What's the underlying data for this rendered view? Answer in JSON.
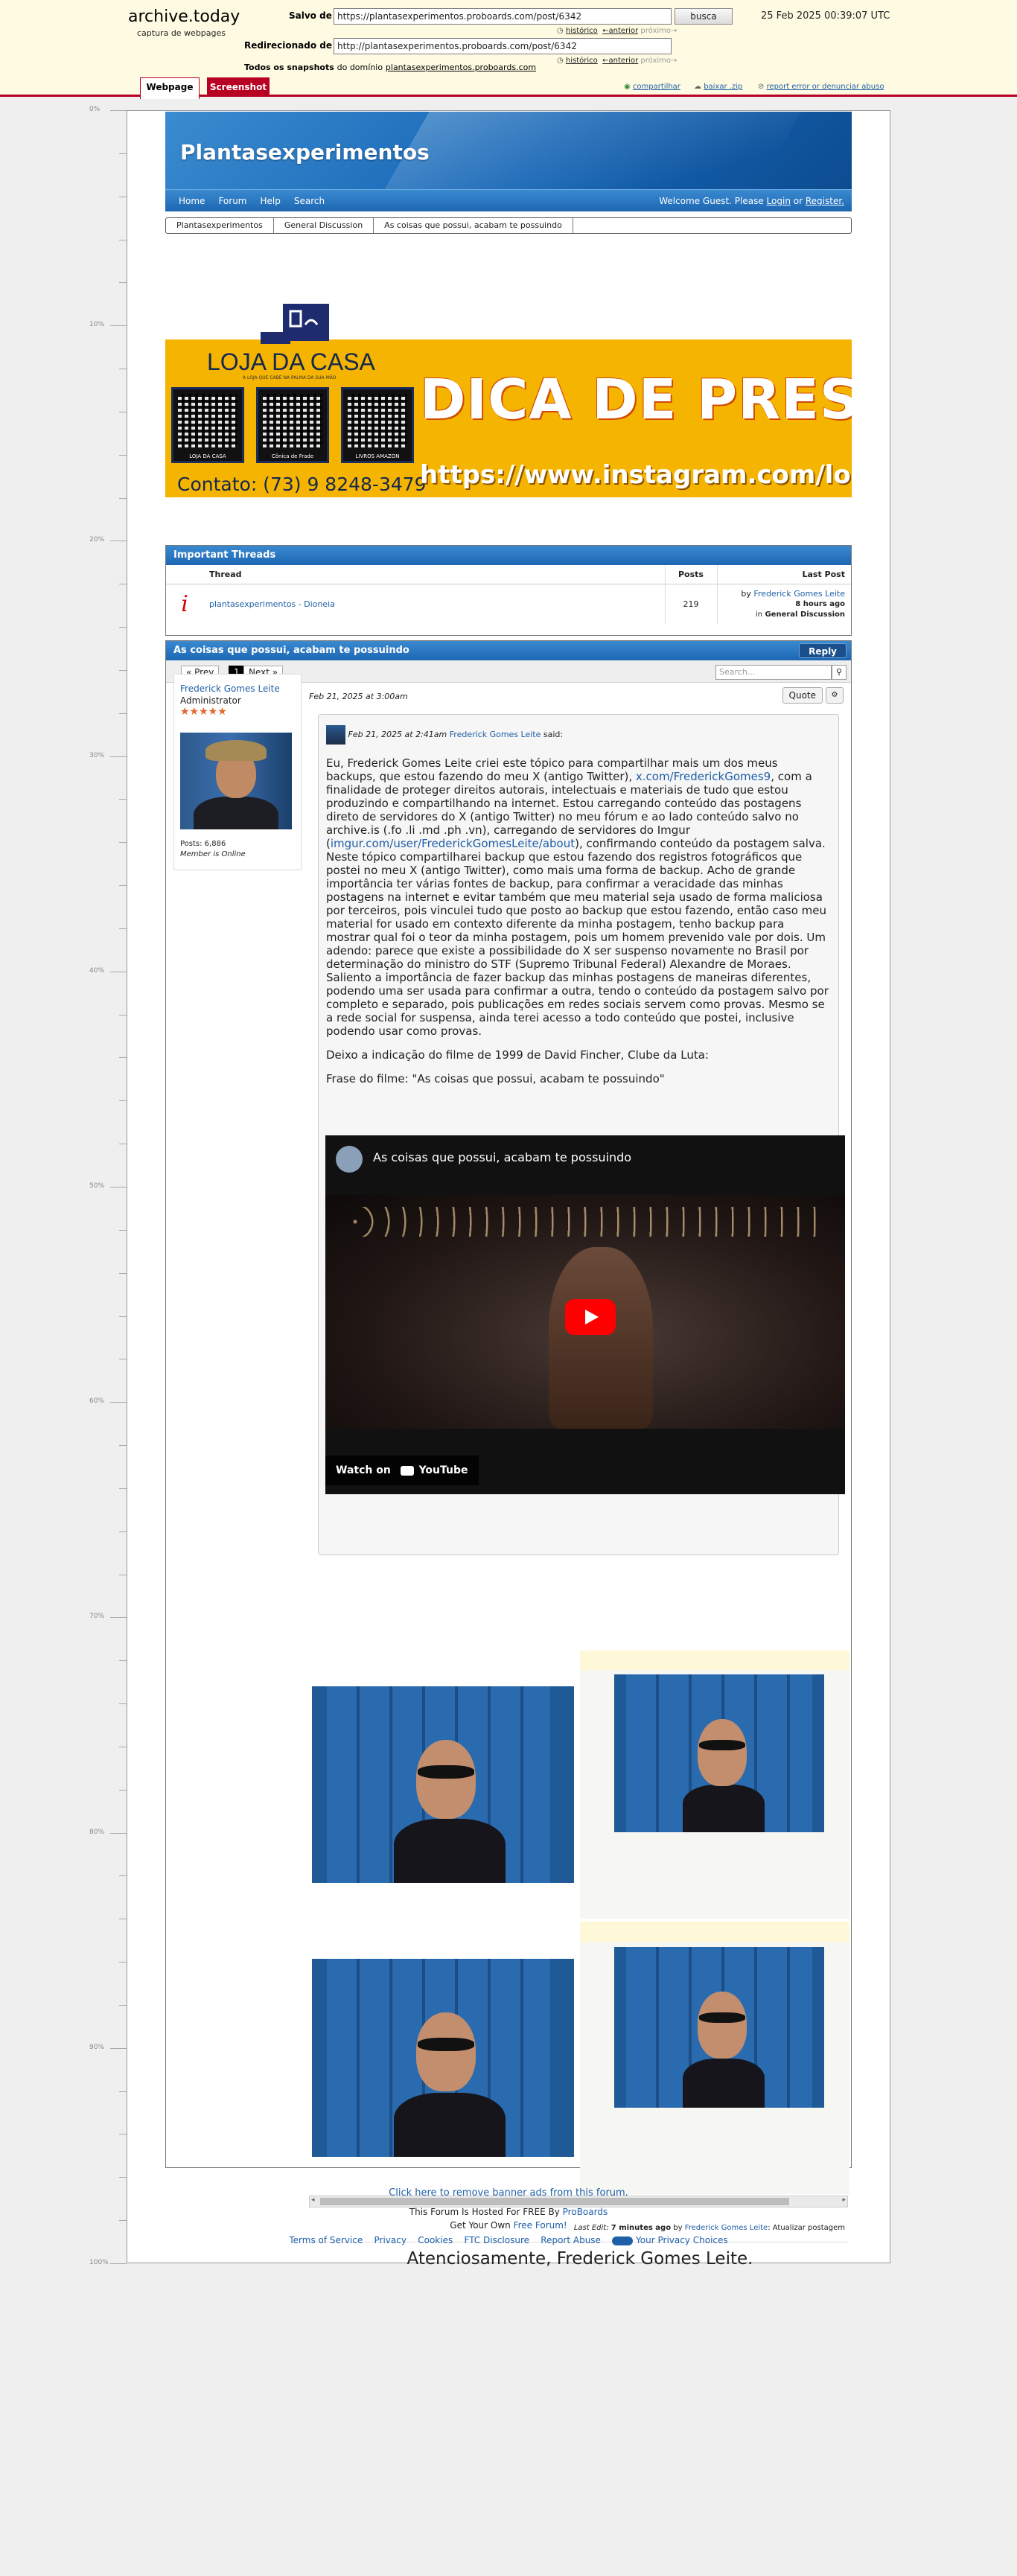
{
  "archive": {
    "logo": "archive.today",
    "logo_sub": "captura de webpages",
    "saved_from_label": "Salvo de",
    "saved_from_url": "https://plantasexperimentos.proboards.com/post/6342",
    "search_button": "busca",
    "date": "25 Feb 2025 00:39:07 UTC",
    "history_1": "histórico",
    "prev_1": "←anterior",
    "next_1": "próximo→",
    "redirected_label": "Redirecionado de",
    "redirected_url": "http://plantasexperimentos.proboards.com/post/6342",
    "history_2": "histórico",
    "prev_2": "←anterior",
    "next_2": "próximo→",
    "snapshots_label": "Todos os snapshots",
    "snapshots_from": "do domínio",
    "snapshots_domain": "plantasexperimentos.proboards.com",
    "tab_webpage": "Webpage",
    "tab_screenshot": "Screenshot",
    "share": "compartilhar",
    "download": "baixar .zip",
    "report": "report error or denunciar abuso"
  },
  "ruler": [
    "0%",
    "10%",
    "20%",
    "30%",
    "40%",
    "50%",
    "60%",
    "70%",
    "80%",
    "90%",
    "100%"
  ],
  "forum": {
    "title": "Plantasexperimentos",
    "nav": [
      "Home",
      "Forum",
      "Help",
      "Search"
    ],
    "welcome_prefix": "Welcome Guest. Please",
    "login": "Login",
    "or": "or",
    "register": "Register.",
    "breadcrumb": [
      "Plantasexperimentos",
      "General Discussion",
      "As coisas que possui, acabam te possuindo"
    ]
  },
  "banner": {
    "loja": "LOJA DA CASA",
    "loja_sub": "A LOJA QUE CABE NA PALMA DA SUA MÃO",
    "qr_labels": [
      "LOJA DA CASA",
      "Cônica de Frade",
      "LIVROS AMAZON"
    ],
    "contato": "Contato: (73) 9 8248-3479",
    "dica": "DICA DE PRESENTE",
    "instagram": "https://www.instagram.com/lo"
  },
  "important": {
    "header": "Important Threads",
    "col_thread": "Thread",
    "col_posts": "Posts",
    "col_last": "Last Post",
    "row_title": "plantasexperimentos - Dioneia",
    "row_posts": "219",
    "row_by": "by",
    "row_author": "Frederick Gomes Leite",
    "row_time": "8 hours ago",
    "row_in": "in",
    "row_board": "General Discussion"
  },
  "thread": {
    "title": "As coisas que possui, acabam te possuindo",
    "reply": "Reply",
    "prev": "« Prev",
    "page": "1",
    "next": "Next »",
    "search_placeholder": "Search..."
  },
  "post": {
    "author": "Frederick Gomes Leite",
    "role": "Administrator",
    "stars": "★★★★★",
    "posts": "Posts: 6,886",
    "status": "Member is Online",
    "date": "Feb 21, 2025 at 3:00am",
    "quote_button": "Quote",
    "quote_date": "Feb 21, 2025 at 2:41am",
    "quote_author": "Frederick Gomes Leite",
    "said": "said:",
    "p1_a": "Eu, Frederick Gomes Leite criei este tópico para compartilhar mais um dos meus backups, que estou fazendo do meu X (antigo Twitter), ",
    "p1_link": "x.com/FrederickGomes9",
    "p1_b": ", com a finalidade de proteger direitos autorais, intelectuais e materiais de tudo que estou produzindo e compartilhando na internet. Estou carregando conteúdo das postagens direto de servidores do X (antigo Twitter) no meu fórum e ao lado conteúdo salvo no archive.is (.fo .li .md .ph .vn), carregando de servidores do Imgur (",
    "p1_link2": "imgur.com/user/FrederickGomesLeite/about",
    "p1_c": "), confirmando conteúdo da postagem salva. Neste tópico compartilharei backup que estou fazendo dos registros fotográficos que postei no meu X (antigo Twitter), como mais uma forma de backup. Acho de grande importância ter várias fontes de backup, para confirmar a veracidade das minhas postagens na internet e evitar também que meu material seja usado de forma maliciosa por terceiros, pois vinculei tudo que posto ao backup que estou fazendo, então caso meu material for usado em contexto diferente da minha postagem, tenho backup para mostrar qual foi o teor da minha postagem, pois um homem prevenido vale por dois. Um adendo: parece que existe a possibilidade do X ser suspenso novamente no Brasil por determinação do ministro do STF (Supremo Tribunal Federal) Alexandre de Moraes. Saliento a importância de fazer backup das minhas postagens de maneiras diferentes, podendo uma ser usada para confirmar a outra, tendo o conteúdo da postagem salvo por completo e separado, pois publicações em redes sociais servem como provas. Mesmo se a rede social for suspensa, ainda terei acesso a todo conteúdo que postei, inclusive podendo usar como provas.",
    "p2": "Deixo a indicação do filme de 1999 de David Fincher, Clube da Luta:",
    "p3": "Frase do filme: \"As coisas que possui, acabam te possuindo\"",
    "video_title": "As coisas que possui, acabam te possuindo",
    "watch_on": "Watch on",
    "youtube": "YouTube",
    "last_edit_label": "Last Edit:",
    "last_edit_time": "7 minutes ago",
    "last_edit_by": "by",
    "last_edit_author": "Frederick Gomes Leite",
    "last_edit_note": ": Atualizar postagem",
    "signature": "Atenciosamente, Frederick Gomes Leite."
  },
  "footer": {
    "remove_ads": "Click here to remove banner ads from this forum.",
    "hosted_prefix": "This Forum Is Hosted For FREE By",
    "proboards": "ProBoards",
    "get_own_prefix": "Get Your Own",
    "free_forum": "Free Forum!",
    "links": [
      "Terms of Service",
      "Privacy",
      "Cookies",
      "FTC Disclosure",
      "Report Abuse"
    ],
    "privacy_choices": "Your Privacy Choices"
  }
}
